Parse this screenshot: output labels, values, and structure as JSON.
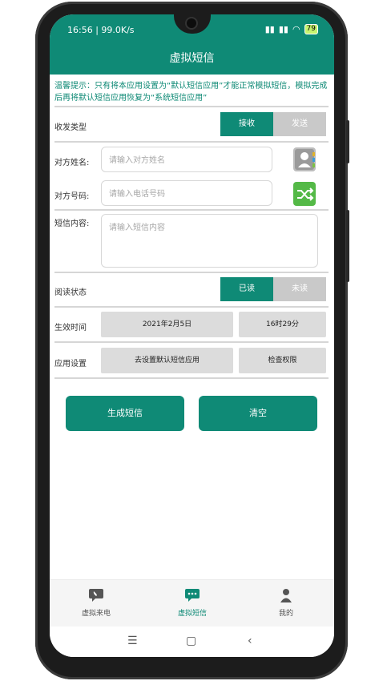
{
  "status_bar": {
    "time_speed": "16:56 | 99.0K/s",
    "battery": "79"
  },
  "app_bar": {
    "title": "虚拟短信"
  },
  "tip": {
    "text": "温馨提示：只有将本应用设置为“默认短信应用”才能正常模拟短信，模拟完成后再将默认短信应用恢复为“系统短信应用”"
  },
  "form": {
    "type_label": "收发类型",
    "type_options": [
      "接收",
      "发送"
    ],
    "type_selected": "接收",
    "name_label": "对方姓名:",
    "name_placeholder": "请输入对方姓名",
    "phone_label": "对方号码:",
    "phone_placeholder": "请输入电话号码",
    "content_label": "短信内容:",
    "content_placeholder": "请输入短信内容",
    "read_label": "阅读状态",
    "read_options": [
      "已读",
      "未读"
    ],
    "read_selected": "已读",
    "time_label": "生效时间",
    "date_value": "2021年2月5日",
    "time_value": "16时29分",
    "settings_label": "应用设置",
    "set_default_button": "去设置默认短信应用",
    "check_permission_button": "检查权限"
  },
  "actions": {
    "generate": "生成短信",
    "clear": "清空"
  },
  "nav": {
    "items": [
      {
        "label": "虚拟来电",
        "icon": "phone-chat-icon"
      },
      {
        "label": "虚拟短信",
        "icon": "sms-chat-icon"
      },
      {
        "label": "我的",
        "icon": "person-icon"
      }
    ],
    "active": "虚拟短信"
  },
  "colors": {
    "accent": "#0f8a76",
    "inactive": "#c9c9c9"
  }
}
